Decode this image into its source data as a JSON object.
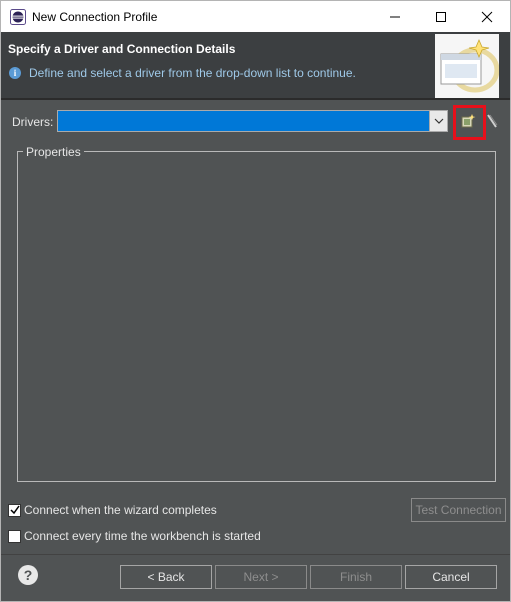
{
  "window": {
    "title": "New Connection Profile"
  },
  "header": {
    "title": "Specify a Driver and Connection Details",
    "description": "Define and select a driver from the drop-down list to continue."
  },
  "drivers": {
    "label": "Drivers:",
    "selected": ""
  },
  "properties": {
    "label": "Properties"
  },
  "options": {
    "connect_on_finish": {
      "label": "Connect when the wizard completes",
      "checked": true
    },
    "connect_on_startup": {
      "label": "Connect every time the workbench is started",
      "checked": false
    }
  },
  "buttons": {
    "test_connection": "Test Connection",
    "back": "< Back",
    "next": "Next >",
    "finish": "Finish",
    "cancel": "Cancel"
  },
  "icons": {
    "app": "eclipse-icon",
    "info": "info-icon",
    "new_driver": "new-driver-icon",
    "edit_driver": "edit-driver-icon",
    "help": "help-icon"
  },
  "colors": {
    "highlight": "#e8101b",
    "combo_selection": "#0078d7",
    "dialog_background": "#505354"
  }
}
